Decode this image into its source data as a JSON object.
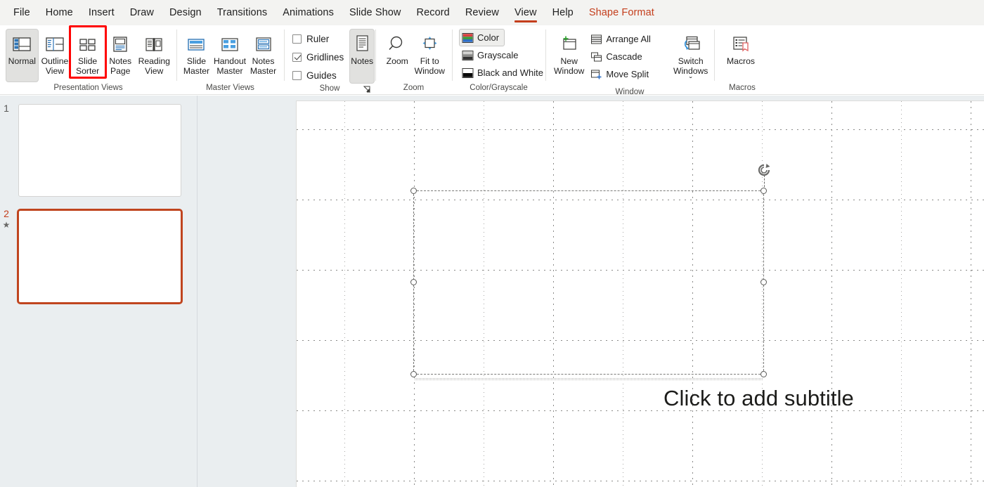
{
  "tabs": [
    {
      "label": "File",
      "state": "normal"
    },
    {
      "label": "Home",
      "state": "normal"
    },
    {
      "label": "Insert",
      "state": "normal"
    },
    {
      "label": "Draw",
      "state": "normal"
    },
    {
      "label": "Design",
      "state": "normal"
    },
    {
      "label": "Transitions",
      "state": "normal"
    },
    {
      "label": "Animations",
      "state": "normal"
    },
    {
      "label": "Slide Show",
      "state": "normal"
    },
    {
      "label": "Record",
      "state": "normal"
    },
    {
      "label": "Review",
      "state": "normal"
    },
    {
      "label": "View",
      "state": "active"
    },
    {
      "label": "Help",
      "state": "normal"
    },
    {
      "label": "Shape Format",
      "state": "contextual"
    }
  ],
  "ribbon": {
    "groups": [
      {
        "name": "presentation-views",
        "label": "Presentation Views",
        "buttons": [
          {
            "label": "Normal",
            "icon": "normal-view-icon",
            "selected": true
          },
          {
            "label": "Outline\nView",
            "icon": "outline-view-icon",
            "selected": false
          },
          {
            "label": "Slide\nSorter",
            "icon": "slide-sorter-icon",
            "selected": false,
            "highlighted": true
          },
          {
            "label": "Notes\nPage",
            "icon": "notes-page-icon",
            "selected": false
          },
          {
            "label": "Reading\nView",
            "icon": "reading-view-icon",
            "selected": false
          }
        ]
      },
      {
        "name": "master-views",
        "label": "Master Views",
        "buttons": [
          {
            "label": "Slide\nMaster",
            "icon": "slide-master-icon",
            "selected": false
          },
          {
            "label": "Handout\nMaster",
            "icon": "handout-master-icon",
            "selected": false
          },
          {
            "label": "Notes\nMaster",
            "icon": "notes-master-icon",
            "selected": false
          }
        ]
      },
      {
        "name": "show",
        "label": "Show",
        "has_dialog_launcher": true,
        "checkboxes": [
          {
            "label": "Ruler",
            "checked": false
          },
          {
            "label": "Gridlines",
            "checked": true
          },
          {
            "label": "Guides",
            "checked": false
          }
        ],
        "buttons": [
          {
            "label": "Notes",
            "icon": "notes-icon",
            "selected": true
          }
        ]
      },
      {
        "name": "zoom",
        "label": "Zoom",
        "buttons": [
          {
            "label": "Zoom",
            "icon": "magnifier-icon",
            "selected": false
          },
          {
            "label": "Fit to\nWindow",
            "icon": "fit-to-window-icon",
            "selected": false
          }
        ]
      },
      {
        "name": "color-grayscale",
        "label": "Color/Grayscale",
        "small_buttons": [
          {
            "label": "Color",
            "icon": "color-icon",
            "selected": true
          },
          {
            "label": "Grayscale",
            "icon": "grayscale-icon",
            "selected": false
          },
          {
            "label": "Black and White",
            "icon": "black-and-white-icon",
            "selected": false
          }
        ]
      },
      {
        "name": "window",
        "label": "Window",
        "buttons": [
          {
            "label": "New\nWindow",
            "icon": "new-window-icon",
            "selected": false
          },
          {
            "label": "Switch\nWindows ˇ",
            "icon": "switch-windows-icon",
            "selected": false
          }
        ],
        "small_buttons": [
          {
            "label": "Arrange All",
            "icon": "arrange-all-icon",
            "selected": false
          },
          {
            "label": "Cascade",
            "icon": "cascade-icon",
            "selected": false
          },
          {
            "label": "Move Split",
            "icon": "move-split-icon",
            "selected": false
          }
        ]
      },
      {
        "name": "macros",
        "label": "Macros",
        "buttons": [
          {
            "label": "Macros",
            "icon": "macros-icon",
            "selected": false
          }
        ]
      }
    ]
  },
  "thumbnails": {
    "slides": [
      {
        "number": "1",
        "selected": false,
        "has_animation": false,
        "star": ""
      },
      {
        "number": "2",
        "selected": true,
        "has_animation": true,
        "star": "★"
      }
    ]
  },
  "canvas": {
    "subtitle_placeholder": "Click to add subtitle",
    "gridlines_visible": true,
    "selected_shape": {
      "name": "subtitle-placeholder",
      "handles": 6,
      "rotation_handle": true
    }
  },
  "colors": {
    "accent": "#c43e1c",
    "annotation": "#ff0000",
    "ribbon_bg": "#ffffff",
    "tabbar_bg": "#f3f3f1",
    "pane_bg": "#eaeef0",
    "selected_thumb_border": "#c0451f"
  }
}
